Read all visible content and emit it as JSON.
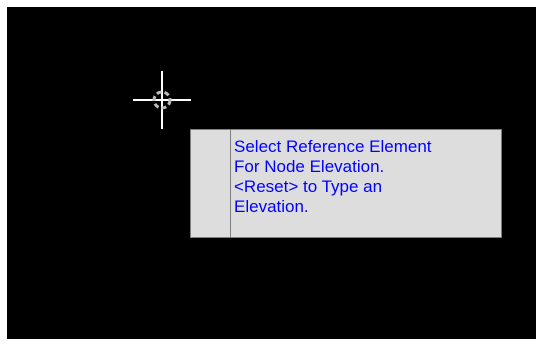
{
  "canvas": {
    "background_color": "#000000",
    "cursor_icon": "crosshair-cursor-icon"
  },
  "prompt": {
    "text": "Select Reference Element\nFor Node Elevation.\n<Reset> to Type an\nElevation.",
    "text_color": "#0000ff",
    "background_color": "#dddddd"
  }
}
